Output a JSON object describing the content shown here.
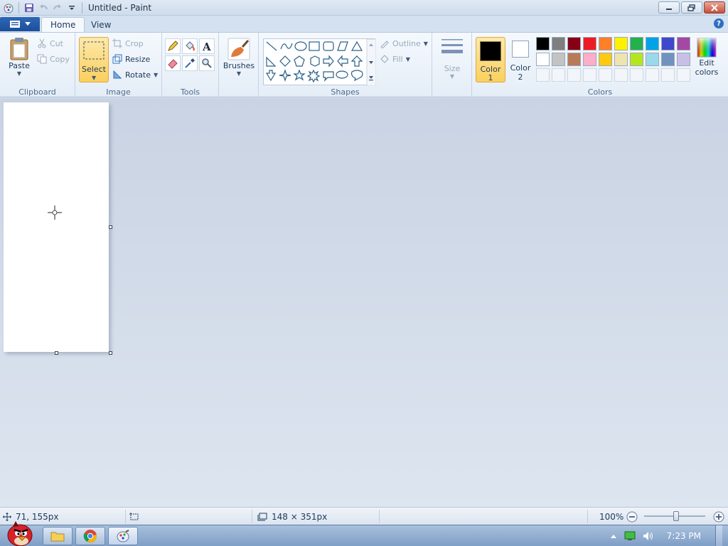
{
  "window": {
    "title": "Untitled - Paint"
  },
  "tabs": [
    {
      "label": "Home"
    },
    {
      "label": "View"
    }
  ],
  "ribbon": {
    "clipboard": {
      "group": "Clipboard",
      "paste": "Paste",
      "cut": "Cut",
      "copy": "Copy"
    },
    "image": {
      "group": "Image",
      "select": "Select",
      "crop": "Crop",
      "resize": "Resize",
      "rotate": "Rotate"
    },
    "tools": {
      "group": "Tools"
    },
    "brushes": {
      "label": "Brushes"
    },
    "shapes": {
      "group": "Shapes",
      "outline": "Outline",
      "fill": "Fill"
    },
    "size": {
      "label": "Size"
    },
    "colors": {
      "group": "Colors",
      "color1": "Color",
      "color1_num": "1",
      "color2": "Color",
      "color2_num": "2",
      "edit1": "Edit",
      "edit2": "colors",
      "color1_value": "#000000",
      "color2_value": "#ffffff",
      "palette_row1": [
        "#000000",
        "#7f7f7f",
        "#880015",
        "#ed1c24",
        "#ff7f27",
        "#fff200",
        "#22b14c",
        "#00a2e8",
        "#3f48cc",
        "#a349a4"
      ],
      "palette_row2": [
        "#ffffff",
        "#c3c3c3",
        "#b97a57",
        "#ffaec9",
        "#ffc90e",
        "#efe4b0",
        "#b5e61d",
        "#99d9ea",
        "#7092be",
        "#c8bfe7"
      ]
    }
  },
  "status": {
    "cursor_pos": "71, 155px",
    "canvas_size": "148 × 351px",
    "zoom": "100%"
  },
  "taskbar": {
    "time": "7:23 PM"
  }
}
